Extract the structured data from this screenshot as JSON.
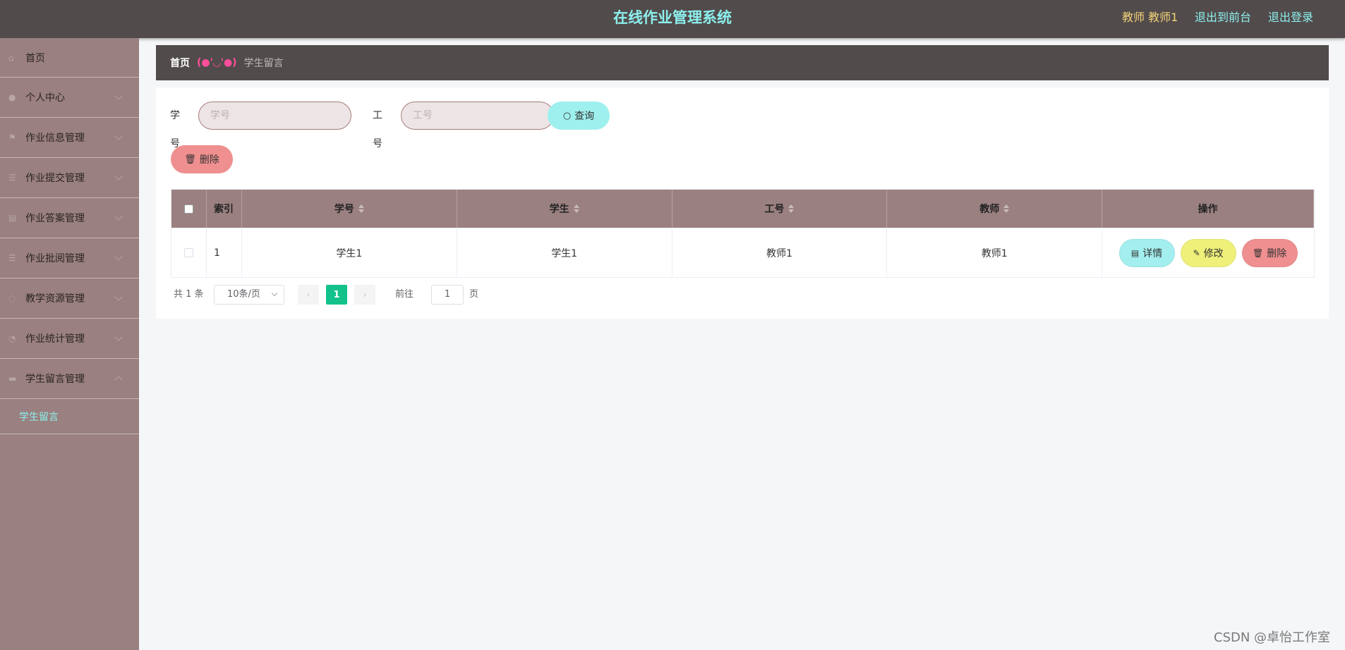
{
  "header": {
    "title": "在线作业管理系统",
    "user_label": "教师 教师1",
    "to_front": "退出到前台",
    "logout": "退出登录"
  },
  "sidebar": {
    "items": [
      {
        "label": "首页",
        "icon": "home-icon"
      },
      {
        "label": "个人中心",
        "icon": "user-icon"
      },
      {
        "label": "作业信息管理",
        "icon": "flag-icon"
      },
      {
        "label": "作业提交管理",
        "icon": "list-icon"
      },
      {
        "label": "作业答案管理",
        "icon": "document-icon"
      },
      {
        "label": "作业批阅管理",
        "icon": "list-icon"
      },
      {
        "label": "教学资源管理",
        "icon": "resource-icon"
      },
      {
        "label": "作业统计管理",
        "icon": "chart-icon"
      },
      {
        "label": "学生留言管理",
        "icon": "message-icon"
      }
    ],
    "sub_item": "学生留言"
  },
  "breadcrumb": {
    "home": "首页",
    "separator": "(●'◡'●)",
    "current": "学生留言"
  },
  "search": {
    "student_no_label": "学号",
    "student_no_placeholder": "学号",
    "teacher_no_label": "工号",
    "teacher_no_placeholder": "工号",
    "query_button": "查询"
  },
  "toolbar": {
    "delete_button": "删除"
  },
  "table": {
    "headers": [
      "索引",
      "学号",
      "学生",
      "工号",
      "教师",
      "操作"
    ],
    "rows": [
      {
        "index": "1",
        "student_no": "学生1",
        "student": "学生1",
        "teacher_no": "教师1",
        "teacher": "教师1"
      }
    ],
    "actions": {
      "detail": "详情",
      "edit": "修改",
      "delete": "删除"
    }
  },
  "pagination": {
    "total": "共 1 条",
    "page_size": "10条/页",
    "current_page": "1",
    "goto_label": "前往",
    "goto_value": "1",
    "page_suffix": "页"
  },
  "watermark": "CSDN @卓怡工作室",
  "colors": {
    "header_bg": "#524b4b",
    "title": "#8cf0ee",
    "sidebar_bg": "#9a8080",
    "accent_pager": "#12c28a"
  }
}
